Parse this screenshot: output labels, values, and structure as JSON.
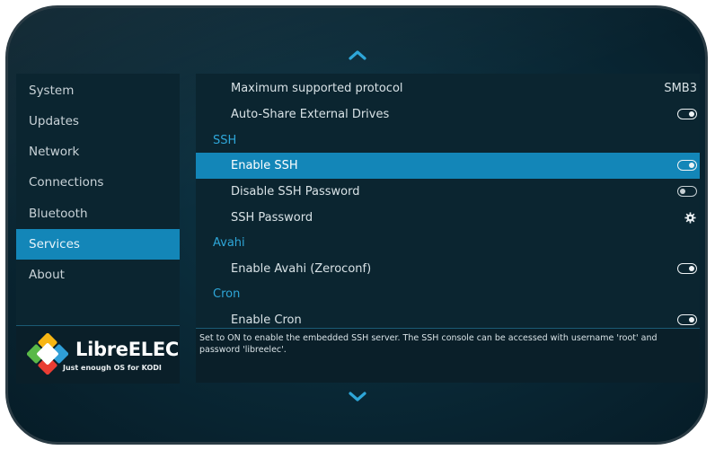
{
  "sidebar": {
    "items": [
      {
        "label": "System",
        "active": false
      },
      {
        "label": "Updates",
        "active": false
      },
      {
        "label": "Network",
        "active": false
      },
      {
        "label": "Connections",
        "active": false
      },
      {
        "label": "Bluetooth",
        "active": false
      },
      {
        "label": "Services",
        "active": true
      },
      {
        "label": "About",
        "active": false
      }
    ],
    "logo": {
      "name": "LibreELEC",
      "tagline": "Just enough OS for KODI"
    }
  },
  "settings": [
    {
      "label": "Maximum supported protocol",
      "type": "value",
      "value": "SMB3"
    },
    {
      "label": "Auto-Share External Drives",
      "type": "toggle",
      "on": true
    },
    {
      "label": "SSH",
      "type": "header"
    },
    {
      "label": "Enable SSH",
      "type": "toggle",
      "on": true,
      "selected": true
    },
    {
      "label": "Disable SSH Password",
      "type": "toggle",
      "on": false
    },
    {
      "label": "SSH Password",
      "type": "action",
      "icon": "gear-icon"
    },
    {
      "label": "Avahi",
      "type": "header"
    },
    {
      "label": "Enable Avahi (Zeroconf)",
      "type": "toggle",
      "on": true
    },
    {
      "label": "Cron",
      "type": "header"
    },
    {
      "label": "Enable Cron",
      "type": "toggle",
      "on": true
    }
  ],
  "description": "Set to ON to enable the embedded SSH server. The SSH console can be accessed with username 'root' and password 'libreelec'.",
  "colors": {
    "accent": "#1386b8",
    "header_text": "#2ea6d8",
    "panel_bg": "#0b2530"
  },
  "icons": {
    "scroll_up": "chevron-up-icon",
    "scroll_down": "chevron-down-icon"
  }
}
